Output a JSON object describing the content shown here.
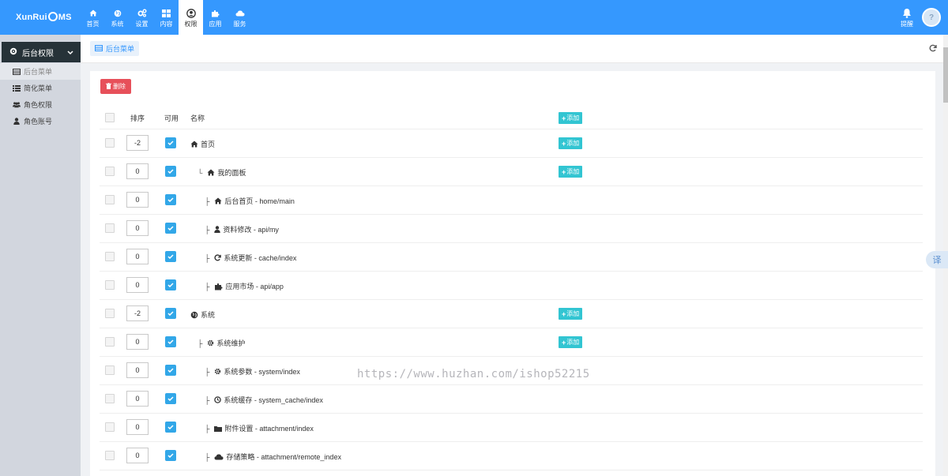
{
  "app": {
    "logo_pre": "XunRui",
    "logo_post": "MS"
  },
  "nav": [
    {
      "label": "首页",
      "icon": "home-icon"
    },
    {
      "label": "系统",
      "icon": "globe-icon"
    },
    {
      "label": "设置",
      "icon": "cogs-icon"
    },
    {
      "label": "内容",
      "icon": "grid-icon"
    },
    {
      "label": "权限",
      "icon": "user-circle-icon",
      "active": true
    },
    {
      "label": "应用",
      "icon": "puzzle-icon"
    },
    {
      "label": "服务",
      "icon": "cloud-icon"
    }
  ],
  "topright": {
    "notify_label": "提醒",
    "avatar_text": "?"
  },
  "sidebar": {
    "section_label": "后台权限",
    "items": [
      {
        "label": "后台菜单",
        "icon": "table-icon",
        "active": true
      },
      {
        "label": "简化菜单",
        "icon": "list-icon"
      },
      {
        "label": "角色权限",
        "icon": "users-icon"
      },
      {
        "label": "角色账号",
        "icon": "user-icon"
      }
    ]
  },
  "tabbar": {
    "tab_label": "后台菜单"
  },
  "toolbar": {
    "delete_label": "删除"
  },
  "table": {
    "headers": {
      "order": "排序",
      "enabled": "可用",
      "name": "名称"
    },
    "add_label": "添加",
    "rows": [
      {
        "order": "-2",
        "level": 0,
        "prefix": "",
        "icon": "home-icon",
        "name": "首页",
        "add": true
      },
      {
        "order": "0",
        "level": 1,
        "prefix": "└",
        "icon": "home-icon",
        "name": "我的面板",
        "add": true
      },
      {
        "order": "0",
        "level": 2,
        "prefix": "├",
        "icon": "home-icon",
        "name": "后台首页 - home/main",
        "add": false
      },
      {
        "order": "0",
        "level": 2,
        "prefix": "├",
        "icon": "user-icon",
        "name": "资料修改 - api/my",
        "add": false
      },
      {
        "order": "0",
        "level": 2,
        "prefix": "├",
        "icon": "refresh-icon",
        "name": "系统更新 - cache/index",
        "add": false
      },
      {
        "order": "0",
        "level": 2,
        "prefix": "├",
        "icon": "puzzle-icon",
        "name": "应用市场 - api/app",
        "add": false
      },
      {
        "order": "-2",
        "level": 0,
        "prefix": "",
        "icon": "globe-icon",
        "name": "系统",
        "add": true
      },
      {
        "order": "0",
        "level": 1,
        "prefix": "├",
        "icon": "cog-icon",
        "name": "系统维护",
        "add": true
      },
      {
        "order": "0",
        "level": 2,
        "prefix": "├",
        "icon": "cog-icon",
        "name": "系统参数 - system/index",
        "add": false
      },
      {
        "order": "0",
        "level": 2,
        "prefix": "├",
        "icon": "clock-icon",
        "name": "系统缓存 - system_cache/index",
        "add": false
      },
      {
        "order": "0",
        "level": 2,
        "prefix": "├",
        "icon": "folder-icon",
        "name": "附件设置 - attachment/index",
        "add": false
      },
      {
        "order": "0",
        "level": 2,
        "prefix": "├",
        "icon": "cloud-icon",
        "name": "存储策略 - attachment/remote_index",
        "add": false
      }
    ]
  },
  "floating": {
    "translate_label": "译"
  },
  "watermark": "https://www.huzhan.com/ishop52215",
  "colors": {
    "primary": "#3598fe",
    "danger": "#e7505a",
    "add": "#32c5d2",
    "check": "#32a7e8",
    "sidebar_dark": "#263238"
  }
}
